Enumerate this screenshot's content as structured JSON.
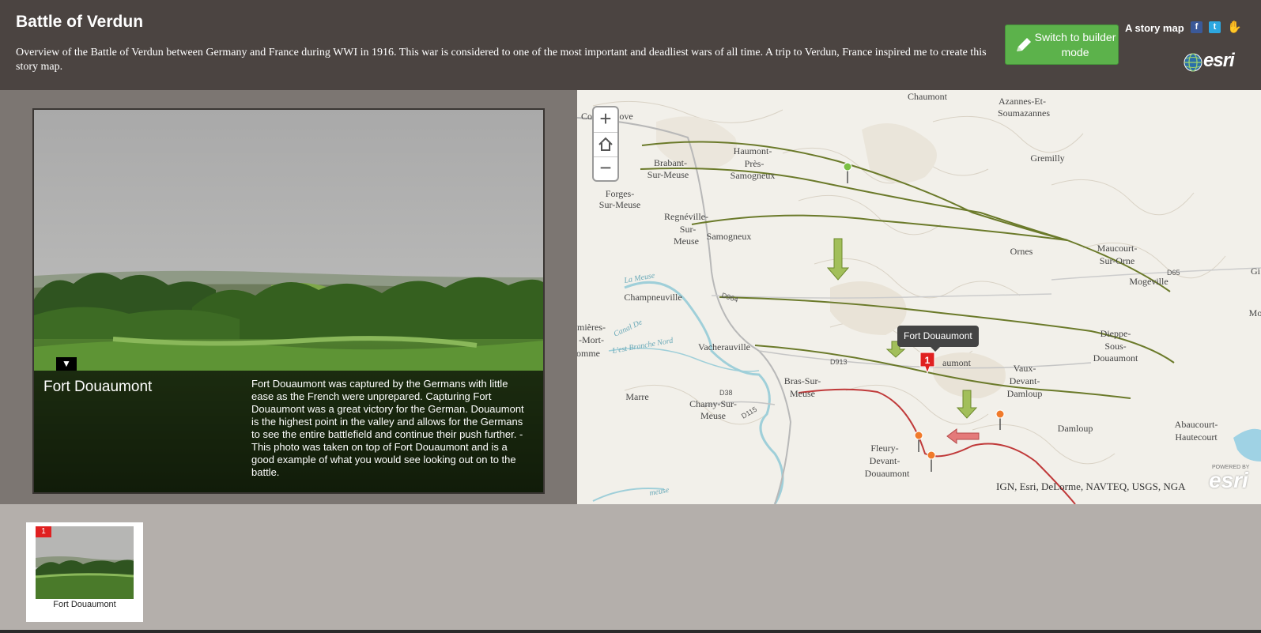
{
  "header": {
    "title": "Battle of Verdun",
    "subtitle": "Overview of the Battle of Verdun between Germany and France during WWI in 1916. This war is considered to one of the most important and deadliest wars of all time. A trip to Verdun, France inspired me to create this story map.",
    "builder_button": "Switch to builder mode",
    "story_map_label": "A story map",
    "share_icons": [
      "facebook-icon",
      "twitter-icon",
      "hand-icon"
    ],
    "logo": "esri"
  },
  "media": {
    "toggle": "▼",
    "caption_title": "Fort Douaumont",
    "caption_text": "Fort Douaumont was captured by the Germans with little ease as the French were unprepared. Capturing Fort Douaumont was a great victory for the German. Douaumont is the highest point in the valley and allows for the Germans to see the entire battlefield and continue their push further. -This photo was taken on top of Fort Douaumont and is a good example of what you would see looking out on to the battle."
  },
  "map": {
    "zoom_in": "+",
    "zoom_out": "−",
    "home": "⌂",
    "tooltip": "Fort Douaumont",
    "selected_marker": "1",
    "attribution": "IGN, Esri, DeLorme, NAVTEQ, USGS, NGA",
    "powered_by": "POWERED BY",
    "powered_logo": "esri",
    "places": [
      "Chaumont",
      "Azannes-Et-",
      "Soumazannes",
      "Co",
      "ove",
      "Haumont-",
      "Près-",
      "Samogneux",
      "Brabant-",
      "Sur-Meuse",
      "Gremilly",
      "Forges-",
      "Sur-Meuse",
      "Regnéville-",
      "Sur-",
      "Meuse",
      "Samogneux",
      "Ornes",
      "Maucourt-",
      "Sur-Orne",
      "Mogeville",
      "Gi",
      "Champneuville",
      "Mo",
      "mières-",
      "-Mort-",
      "omme",
      "Vacherauville",
      "aumont",
      "Dieppe-",
      "Sous-",
      "Douaumont",
      "Vaux-",
      "Devant-",
      "Damloup",
      "Bras-Sur-",
      "Meuse",
      "Marre",
      "Charny-Sur-",
      "Meuse",
      "Damloup",
      "Abaucourt-",
      "Hautecourt",
      "Fleury-",
      "Devant-",
      "Douaumont",
      "La Meuse",
      "Canal De",
      "L'est Branche Nord",
      "meuse",
      "D964",
      "D913",
      "D38",
      "D115",
      "D65"
    ]
  },
  "thumbnails": [
    {
      "badge": "1",
      "label": "Fort Douaumont"
    }
  ],
  "colors": {
    "header_bg": "#4b4441",
    "builder_button": "#5cb24b",
    "front_line": "#6b7a2a",
    "french_line": "#c03a3a",
    "marker_red": "#e02020"
  }
}
